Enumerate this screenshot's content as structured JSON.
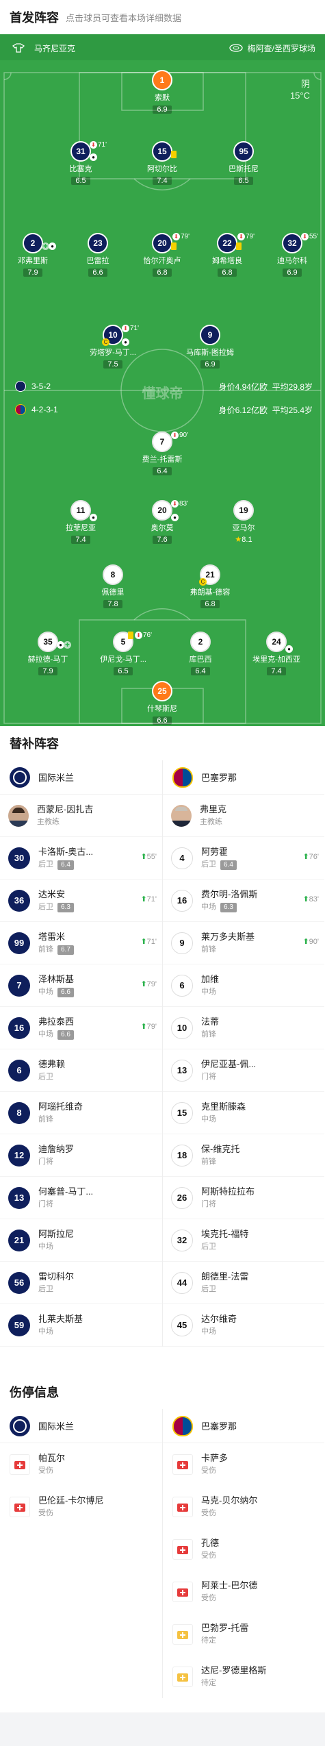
{
  "lineup_header": {
    "title": "首发阵容",
    "subtitle": "点击球员可查看本场详细数据"
  },
  "home_team_name": "马齐尼亚克",
  "away_team_name": "梅阿查/圣西罗球场",
  "weather": {
    "condition": "阴",
    "temp": "15°C"
  },
  "home_formation": "3-5-2",
  "away_formation": "4-2-3-1",
  "home_value": "身价4.94亿欧",
  "home_age": "平均29.8岁",
  "away_value": "身价6.12亿欧",
  "away_age": "平均25.4岁",
  "watermark": "懂球帝",
  "home_players": [
    {
      "no": "1",
      "name": "索默",
      "rating": "6.9"
    },
    {
      "no": "31",
      "name": "比塞克",
      "rating": "6.5",
      "sub": "71'"
    },
    {
      "no": "15",
      "name": "阿切尔比",
      "rating": "7.4"
    },
    {
      "no": "95",
      "name": "巴斯托尼",
      "rating": "6.5"
    },
    {
      "no": "2",
      "name": "邓弗里斯",
      "rating": "7.9"
    },
    {
      "no": "23",
      "name": "巴雷拉",
      "rating": "6.6"
    },
    {
      "no": "20",
      "name": "恰尔汗奥卢",
      "rating": "6.8",
      "sub": "79'"
    },
    {
      "no": "22",
      "name": "姆希塔良",
      "rating": "6.8",
      "sub": "79'"
    },
    {
      "no": "32",
      "name": "迪马尔科",
      "rating": "6.9",
      "sub": "55'"
    },
    {
      "no": "10",
      "name": "劳塔罗-马丁...",
      "rating": "7.5",
      "sub": "71'"
    },
    {
      "no": "9",
      "name": "马库斯-图拉姆",
      "rating": "6.9"
    }
  ],
  "away_players": [
    {
      "no": "7",
      "name": "费兰-托雷斯",
      "rating": "6.4",
      "sub": "90'"
    },
    {
      "no": "11",
      "name": "拉菲尼亚",
      "rating": "7.4"
    },
    {
      "no": "20",
      "name": "奥尔莫",
      "rating": "7.6",
      "sub": "83'"
    },
    {
      "no": "19",
      "name": "亚马尔",
      "rating": "8.1"
    },
    {
      "no": "8",
      "name": "佩德里",
      "rating": "7.8"
    },
    {
      "no": "21",
      "name": "弗朗基-德容",
      "rating": "6.8"
    },
    {
      "no": "35",
      "name": "赫拉德-马丁",
      "rating": "7.9"
    },
    {
      "no": "5",
      "name": "伊尼戈-马丁...",
      "rating": "6.5",
      "sub": "76'"
    },
    {
      "no": "2",
      "name": "库巴西",
      "rating": "6.4"
    },
    {
      "no": "24",
      "name": "埃里克-加西亚",
      "rating": "7.4"
    },
    {
      "no": "25",
      "name": "什琴斯尼",
      "rating": "6.6"
    }
  ],
  "bench_header": {
    "title": "替补阵容"
  },
  "home_club": "国际米兰",
  "away_club": "巴塞罗那",
  "home_coach": {
    "name": "西蒙尼-因扎吉",
    "role": "主教练"
  },
  "away_coach": {
    "name": "弗里克",
    "role": "主教练"
  },
  "home_bench": [
    {
      "no": "30",
      "name": "卡洛斯-奥古...",
      "pos": "后卫",
      "rating": "6.4",
      "sub": "55'"
    },
    {
      "no": "36",
      "name": "达米安",
      "pos": "后卫",
      "rating": "6.3",
      "sub": "71'"
    },
    {
      "no": "99",
      "name": "塔雷米",
      "pos": "前锋",
      "rating": "6.7",
      "sub": "71'"
    },
    {
      "no": "7",
      "name": "泽林斯基",
      "pos": "中场",
      "rating": "6.6",
      "sub": "79'"
    },
    {
      "no": "16",
      "name": "弗拉泰西",
      "pos": "中场",
      "rating": "6.6",
      "sub": "79'"
    },
    {
      "no": "6",
      "name": "德弗赖",
      "pos": "后卫"
    },
    {
      "no": "8",
      "name": "阿瑙托维奇",
      "pos": "前锋"
    },
    {
      "no": "12",
      "name": "迪詹纳罗",
      "pos": "门将"
    },
    {
      "no": "13",
      "name": "何塞普-马丁...",
      "pos": "门将"
    },
    {
      "no": "21",
      "name": "阿斯拉尼",
      "pos": "中场"
    },
    {
      "no": "56",
      "name": "雷切科尔",
      "pos": "后卫"
    },
    {
      "no": "59",
      "name": "扎莱夫斯基",
      "pos": "中场"
    }
  ],
  "away_bench": [
    {
      "no": "4",
      "name": "阿劳霍",
      "pos": "后卫",
      "rating": "6.4",
      "sub": "76'"
    },
    {
      "no": "16",
      "name": "费尔明-洛佩斯",
      "pos": "中场",
      "rating": "6.3",
      "sub": "83'"
    },
    {
      "no": "9",
      "name": "莱万多夫斯基",
      "pos": "前锋",
      "sub": "90'"
    },
    {
      "no": "6",
      "name": "加维",
      "pos": "中场"
    },
    {
      "no": "10",
      "name": "法蒂",
      "pos": "前锋"
    },
    {
      "no": "13",
      "name": "伊尼亚基-佩...",
      "pos": "门将"
    },
    {
      "no": "15",
      "name": "克里斯滕森",
      "pos": "中场"
    },
    {
      "no": "18",
      "name": "保-维克托",
      "pos": "前锋"
    },
    {
      "no": "26",
      "name": "阿斯特拉拉布",
      "pos": "门将"
    },
    {
      "no": "32",
      "name": "埃克托-福特",
      "pos": "后卫"
    },
    {
      "no": "44",
      "name": "朗德里-法雷",
      "pos": "后卫"
    },
    {
      "no": "45",
      "name": "达尔维奇",
      "pos": "中场"
    }
  ],
  "injury_header": {
    "title": "伤停信息"
  },
  "home_injuries": [
    {
      "name": "帕瓦尔",
      "status": "受伤"
    },
    {
      "name": "巴伦廷-卡尔博尼",
      "status": "受伤"
    }
  ],
  "away_injuries": [
    {
      "name": "卡萨多",
      "status": "受伤"
    },
    {
      "name": "马克-贝尔纳尔",
      "status": "受伤"
    },
    {
      "name": "孔德",
      "status": "受伤"
    },
    {
      "name": "阿莱士-巴尔德",
      "status": "受伤"
    },
    {
      "name": "巴勃罗-托雷",
      "status": "待定"
    },
    {
      "name": "达尼-罗德里格斯",
      "status": "待定"
    }
  ],
  "colors": {
    "pitch": "#36a548",
    "home": "#0f1f5c",
    "gk": "#ff7a1a",
    "sub_green": "#2bb24c",
    "injury_red": "#e63b3b"
  }
}
